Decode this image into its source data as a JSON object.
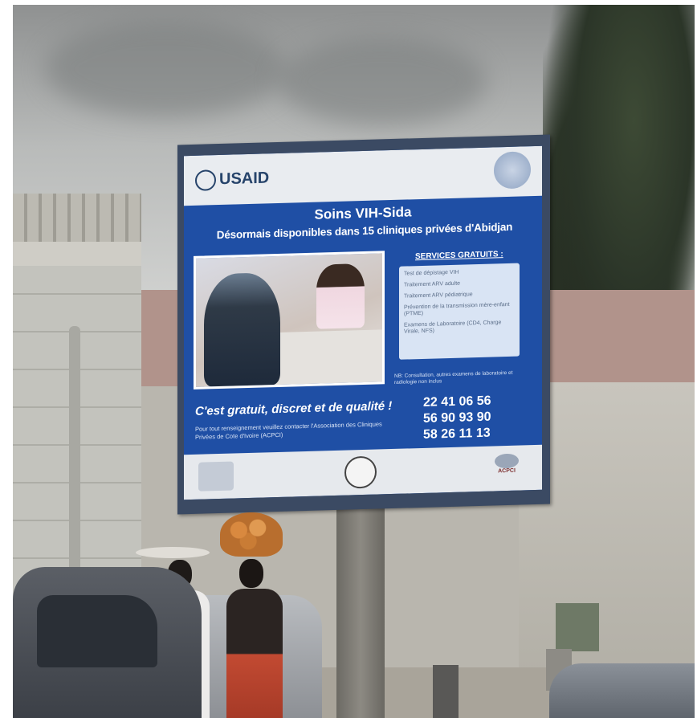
{
  "billboard": {
    "sponsor_logo_text": "USAID",
    "headline": "Soins VIH-Sida",
    "subline": "Désormais disponibles dans 15 cliniques privées d'Abidjan",
    "services_title": "SERVICES GRATUITS :",
    "services": [
      "Test de dépistage VIH",
      "Traitement ARV adulte",
      "Traitement ARV pédiatrique",
      "Prévention de la transmission mère-enfant (PTME)",
      "Examens de Laboratoire (CD4, Charge Virale, NFS)"
    ],
    "services_note": "NB: Consultation, autres examens de laboratoire et radiologie non inclus",
    "slogan": "C'est gratuit, discret et de qualité !",
    "contact_text": "Pour tout renseignement veuillez contacter l'Association des Cliniques Privées de Cote d'Ivoire (ACPCI)",
    "phones": [
      "22 41 06 56",
      "56 90 93 90",
      "58 26 11 13"
    ],
    "bottom_right_logo_text": "ACPCI"
  },
  "colors": {
    "billboard_blue": "#1f4fa5",
    "panel_white": "#e9ecf0",
    "frame": "#3b4a63"
  }
}
